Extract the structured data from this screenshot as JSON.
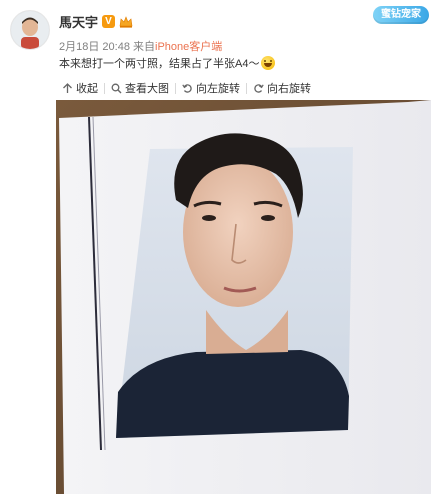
{
  "author": {
    "name": "馬天宇",
    "verified_badge": "V"
  },
  "top_badge": {
    "label": "蜜钻宠家"
  },
  "meta": {
    "date": "2月18日",
    "time": "20:48",
    "from_text": "来自",
    "source": "iPhone客户端"
  },
  "post": {
    "text": "本来想打一个两寸照，结果占了半张A4～",
    "emoji_name": "laugh-emoji"
  },
  "toolbar": {
    "collapse_label": "收起",
    "view_large_label": "查看大图",
    "rotate_left_label": "向左旋转",
    "rotate_right_label": "向右旋转"
  },
  "colors": {
    "accent_source": "#eb7350",
    "verified_orange": "#f69a0f",
    "photo_backdrop": "#6b4f37"
  }
}
